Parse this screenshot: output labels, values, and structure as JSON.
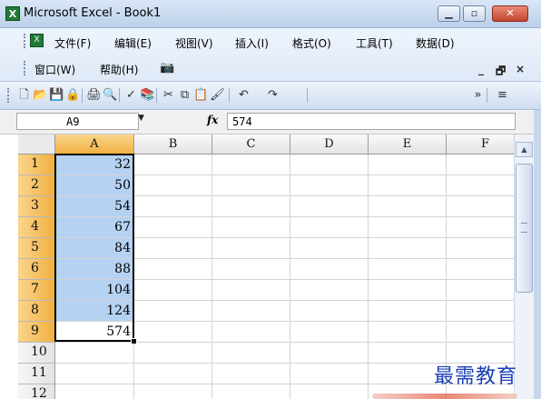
{
  "window": {
    "title": "Microsoft Excel - Book1",
    "app_icon": "excel-icon",
    "controls": [
      "minimize-icon",
      "maximize-icon",
      "close-icon"
    ]
  },
  "menubar": {
    "items": [
      {
        "label": "文件(F)"
      },
      {
        "label": "编辑(E)"
      },
      {
        "label": "视图(V)"
      },
      {
        "label": "插入(I)"
      },
      {
        "label": "格式(O)"
      },
      {
        "label": "工具(T)"
      },
      {
        "label": "数据(D)"
      },
      {
        "label": "窗口(W)"
      },
      {
        "label": "帮助(H)"
      }
    ],
    "doc_controls": {
      "minimize": "_",
      "restore": "🗗",
      "close": "×"
    }
  },
  "toolbar": {
    "buttons": [
      {
        "icon": "new-document-icon",
        "glyph": "🗋"
      },
      {
        "icon": "open-folder-icon",
        "glyph": "📂"
      },
      {
        "icon": "save-icon",
        "glyph": "💾"
      },
      {
        "icon": "permission-icon",
        "glyph": "🔒"
      },
      {
        "icon": "print-icon",
        "glyph": "🖨"
      },
      {
        "icon": "print-preview-icon",
        "glyph": "🔍"
      },
      {
        "icon": "spelling-icon",
        "glyph": "✓"
      },
      {
        "icon": "research-icon",
        "glyph": "📚"
      },
      {
        "icon": "cut-icon",
        "glyph": "✂"
      },
      {
        "icon": "copy-icon",
        "glyph": "⧉"
      },
      {
        "icon": "paste-icon",
        "glyph": "📋"
      },
      {
        "icon": "format-painter-icon",
        "glyph": "🖌"
      },
      {
        "icon": "undo-icon",
        "glyph": "↶"
      },
      {
        "icon": "redo-icon",
        "glyph": "↷"
      },
      {
        "icon": "toolbar-options-icon",
        "glyph": "»"
      },
      {
        "icon": "align-center-icon",
        "glyph": "≡"
      }
    ]
  },
  "formula_bar": {
    "name_box": "A9",
    "fx_label": "fx",
    "formula": "574"
  },
  "sheet": {
    "columns": [
      "A",
      "B",
      "C",
      "D",
      "E",
      "F"
    ],
    "selected_column": "A",
    "rows": [
      {
        "num": "1",
        "a": "32",
        "selected": true
      },
      {
        "num": "2",
        "a": "50",
        "selected": true
      },
      {
        "num": "3",
        "a": "54",
        "selected": true
      },
      {
        "num": "4",
        "a": "67",
        "selected": true
      },
      {
        "num": "5",
        "a": "84",
        "selected": true
      },
      {
        "num": "6",
        "a": "88",
        "selected": true
      },
      {
        "num": "7",
        "a": "104",
        "selected": true
      },
      {
        "num": "8",
        "a": "124",
        "selected": true
      },
      {
        "num": "9",
        "a": "574",
        "selected": true,
        "active": true
      },
      {
        "num": "10",
        "a": "",
        "selected": false
      },
      {
        "num": "11",
        "a": "",
        "selected": false
      },
      {
        "num": "12",
        "a": "",
        "selected": false
      }
    ]
  },
  "watermark": "最需教育",
  "colors": {
    "selection_fill": "#b5d2f2",
    "header_highlight": "#f1b041",
    "watermark": "#1a3fb7"
  }
}
